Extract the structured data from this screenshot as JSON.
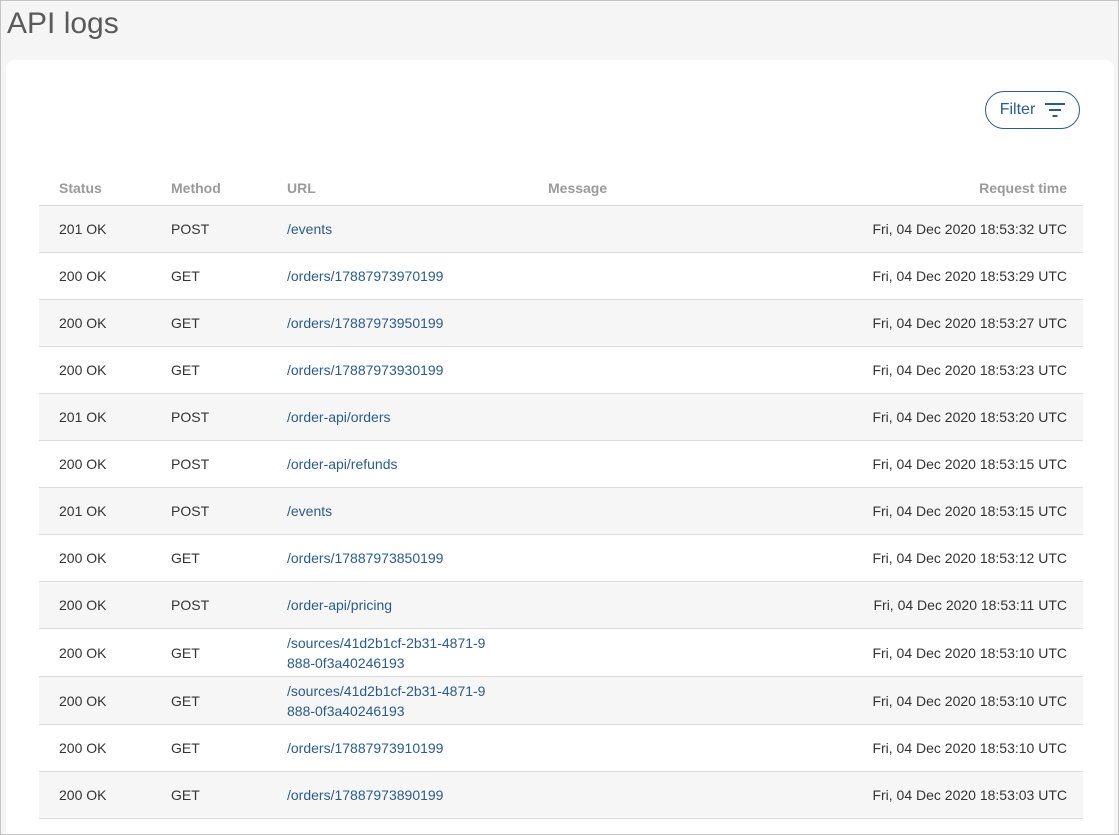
{
  "page": {
    "title": "API logs"
  },
  "toolbar": {
    "filter_label": "Filter",
    "filter_icon": "filter-list-icon"
  },
  "colors": {
    "accent": "#2a5b8c",
    "row_alt": "#f6f6f6",
    "header_text": "#9a9a9a"
  },
  "table": {
    "headers": {
      "status": "Status",
      "method": "Method",
      "url": "URL",
      "message": "Message",
      "request_time": "Request time"
    },
    "rows": [
      {
        "status": "201 OK",
        "method": "POST",
        "url": "/events",
        "message": "",
        "time": "Fri, 04 Dec 2020 18:53:32 UTC"
      },
      {
        "status": "200 OK",
        "method": "GET",
        "url": "/orders/17887973970199",
        "message": "",
        "time": "Fri, 04 Dec 2020 18:53:29 UTC"
      },
      {
        "status": "200 OK",
        "method": "GET",
        "url": "/orders/17887973950199",
        "message": "",
        "time": "Fri, 04 Dec 2020 18:53:27 UTC"
      },
      {
        "status": "200 OK",
        "method": "GET",
        "url": "/orders/17887973930199",
        "message": "",
        "time": "Fri, 04 Dec 2020 18:53:23 UTC"
      },
      {
        "status": "201 OK",
        "method": "POST",
        "url": "/order-api/orders",
        "message": "",
        "time": "Fri, 04 Dec 2020 18:53:20 UTC"
      },
      {
        "status": "200 OK",
        "method": "POST",
        "url": "/order-api/refunds",
        "message": "",
        "time": "Fri, 04 Dec 2020 18:53:15 UTC"
      },
      {
        "status": "201 OK",
        "method": "POST",
        "url": "/events",
        "message": "",
        "time": "Fri, 04 Dec 2020 18:53:15 UTC"
      },
      {
        "status": "200 OK",
        "method": "GET",
        "url": "/orders/17887973850199",
        "message": "",
        "time": "Fri, 04 Dec 2020 18:53:12 UTC"
      },
      {
        "status": "200 OK",
        "method": "POST",
        "url": "/order-api/pricing",
        "message": "",
        "time": "Fri, 04 Dec 2020 18:53:11 UTC"
      },
      {
        "status": "200 OK",
        "method": "GET",
        "url": "/sources/41d2b1cf-2b31-4871-9888-0f3a40246193",
        "message": "",
        "time": "Fri, 04 Dec 2020 18:53:10 UTC"
      },
      {
        "status": "200 OK",
        "method": "GET",
        "url": "/sources/41d2b1cf-2b31-4871-9888-0f3a40246193",
        "message": "",
        "time": "Fri, 04 Dec 2020 18:53:10 UTC"
      },
      {
        "status": "200 OK",
        "method": "GET",
        "url": "/orders/17887973910199",
        "message": "",
        "time": "Fri, 04 Dec 2020 18:53:10 UTC"
      },
      {
        "status": "200 OK",
        "method": "GET",
        "url": "/orders/17887973890199",
        "message": "",
        "time": "Fri, 04 Dec 2020 18:53:03 UTC"
      }
    ]
  }
}
